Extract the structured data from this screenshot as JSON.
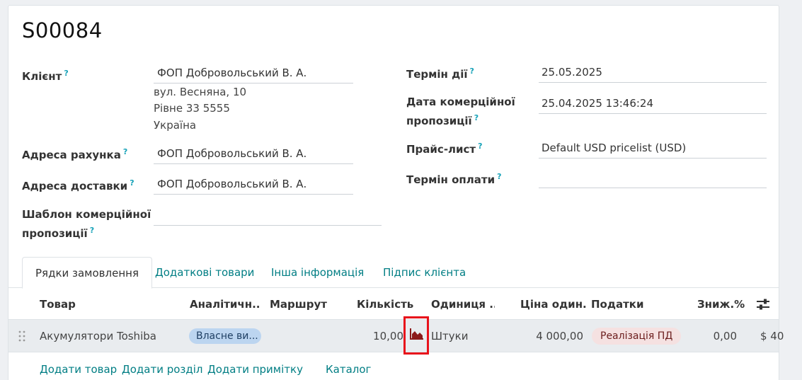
{
  "record": {
    "title": "S00084"
  },
  "left_fields": {
    "client_label": "Клієнт",
    "client_value": "ФОП Добровольський В. А.",
    "address": [
      "вул. Весняна, 10",
      "Рівне 33 5555",
      "Україна"
    ],
    "invoice_label": "Адреса рахунка",
    "invoice_value": "ФОП Добровольський В. А.",
    "delivery_label": "Адреса доставки",
    "delivery_value": "ФОП Добровольський В. А.",
    "template_label_1": "Шаблон комерційної",
    "template_label_2": "пропозиції",
    "template_value": ""
  },
  "right_fields": {
    "validity_label": "Термін дії",
    "validity_value": "25.05.2025",
    "quote_date_label_1": "Дата комерційної",
    "quote_date_label_2": "пропозиції",
    "quote_date_value": "25.04.2025 13:46:24",
    "pricelist_label": "Прайс-лист",
    "pricelist_value": "Default USD pricelist (USD)",
    "payment_label": "Термін оплати",
    "payment_value": ""
  },
  "help_mark": "?",
  "tabs": [
    "Рядки замовлення",
    "Додаткові товари",
    "Інша інформація",
    "Підпис клієнта"
  ],
  "table": {
    "headers": [
      "Товар",
      "Аналітичн...",
      "Маршрут",
      "Кількість",
      "Одиниця ...",
      "Ціна один...",
      "Податки",
      "Зниж.%"
    ],
    "rows": [
      {
        "product": "Акумулятори Toshiba",
        "analytic": "Власне ви...",
        "route": "",
        "quantity": "10,00",
        "uom": "Штуки",
        "unit_price": "4 000,00",
        "taxes": "Реалізація ПД",
        "discount": "0,00",
        "subtotal": "$ 40"
      }
    ]
  },
  "actions": [
    "Додати товар",
    "Додати розділ",
    "Додати примітку",
    "Каталог"
  ],
  "icons": {
    "forecast": "area-chart-icon",
    "settings": "sliders-icon",
    "handle": "drag-handle-icon"
  },
  "colors": {
    "link": "#017e84",
    "help": "#17a2b8",
    "highlight": "#e8121b",
    "forecast_icon": "#8b1a1a"
  }
}
